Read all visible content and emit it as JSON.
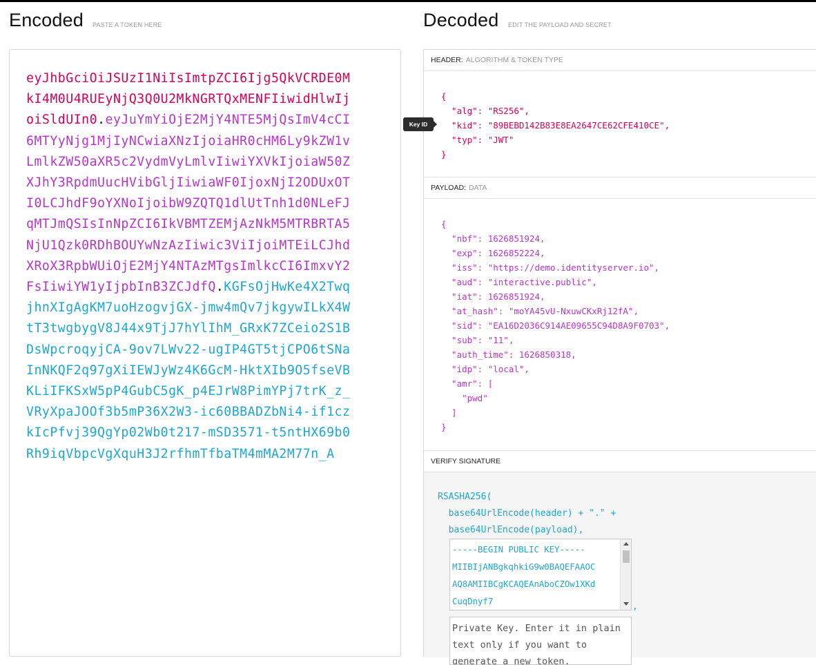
{
  "encoded": {
    "title": "Encoded",
    "subtitle": "PASTE A TOKEN HERE",
    "token_header": "eyJhbGciOiJSUzI1NiIsImtpZCI6Ijg5QkVCRDE0MkI4M0U4RUEyNjQ3Q0U2MkNGRTQxMENFIiwidHlwIjoiSldUIn0",
    "token_payload": "eyJuYmYiOjE2MjY4NTE5MjQsImV4cCI6MTYyNjg1MjIyNCwiaXNzIjoiaHR0cHM6Ly9kZW1vLmlkZW50aXR5c2VydmVyLmlvIiwiYXVkIjoiaW50ZXJhY3RpdmUucHVibGljIiwiaWF0IjoxNjI2ODUxOTI0LCJhdF9oYXNoIjoibW9ZQTQ1dlUtTnh1d0NLeFJqMTJmQSIsInNpZCI6IkVBMTZEMjAzNkM5MTRBRTA5NjU1Qzk0RDhBOUYwNzAzIiwic3ViIjoiMTEiLCJhdXRoX3RpbWUiOjE2MjY4NTAzMTgsImlkcCI6ImxvY2FsIiwiYW1yIjpbInB3ZCJdfQ",
    "token_signature": "KGFsOjHwKe4X2TwqjhnXIgAgKM7uoHzogvjGX-jmw4mQv7jkgywILkX4WtT3twgbygV8J44x9TjJ7hYlIhM_GRxK7ZCeio2S1BDsWpcroqyjCA-9ov7LWv22-ugIP4GT5tjCPO6tSNaInNKQF2q97gXiIEWJyWz4K6GcM-HktXIb9O5fseVBKLiIFKSxW5pP4GubC5gK_p4EJrW8PimYPj7trK_z_VRyXpaJOOf3b5mP36X2W3-ic60BBADZbNi4-if1czkIcPfvj39QgYp02Wb0t217-mSD3571-t5ntHX69b0Rh9iqVbpcVgXquH3J2rfhmTfbaTM4mMA2M77n_A"
  },
  "decoded": {
    "title": "Decoded",
    "subtitle": "EDIT THE PAYLOAD AND SECRET",
    "header_label": "HEADER:",
    "header_sub": "ALGORITHM & TOKEN TYPE",
    "payload_label": "PAYLOAD:",
    "payload_sub": "DATA",
    "verify_label": "VERIFY SIGNATURE",
    "tooltip": "Key ID",
    "header_json": "{\n  \"alg\": \"RS256\",\n  \"kid\": \"89BEBD142B83E8EA2647CE62CFE410CE\",\n  \"typ\": \"JWT\"\n}",
    "payload_json": "{\n  \"nbf\": 1626851924,\n  \"exp\": 1626852224,\n  \"iss\": \"https://demo.identityserver.io\",\n  \"aud\": \"interactive.public\",\n  \"iat\": 1626851924,\n  \"at_hash\": \"moYA45vU-NxuwCKxRj12fA\",\n  \"sid\": \"EA16D2036C914AE09655C94D8A9F0703\",\n  \"sub\": \"11\",\n  \"auth_time\": 1626850318,\n  \"idp\": \"local\",\n  \"amr\": [\n    \"pwd\"\n  ]\n}",
    "verify_code": "RSASHA256(\n  base64UrlEncode(header) + \".\" +\n  base64UrlEncode(payload),",
    "public_key": "-----BEGIN PUBLIC KEY-----\nMIIBIjANBgkqhkiG9w0BAQEFAAOC\nAQ8AMIIBCgKCAQEAnAboCZOw1XKd\nCuqDnyf7",
    "comma": ",",
    "private_key_placeholder": "Private Key. Enter it in plain text only if you want to generate a new token."
  }
}
